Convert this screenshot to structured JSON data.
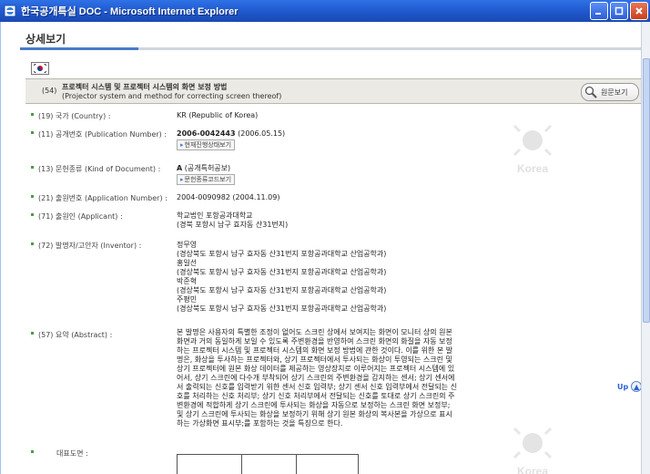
{
  "window": {
    "title": "한국공개특실 DOC - Microsoft Internet Explorer"
  },
  "page": {
    "heading": "상세보기"
  },
  "patent": {
    "num_code": "(54)",
    "title_ko": "프로젝터 시스템 및 프로젝터 시스템의 화면 보정 방법",
    "title_en": "(Projector system and method for correcting screen thereof)",
    "original_button": "원문보기"
  },
  "fields": {
    "country": {
      "label": "(19) 국가 (Country) :",
      "value": "KR (Republic of Korea)"
    },
    "publication": {
      "label": "(11) 공개번호 (Publication Number) :",
      "number": "2006-0042443",
      "date": "(2006.05.15)",
      "button": "현재진행상태보기"
    },
    "kind": {
      "label": "(13) 문헌종류 (Kind of Document) :",
      "code": "A",
      "desc": "(공개특허공보)",
      "button": "문헌종류코드보기"
    },
    "application": {
      "label": "(21) 출원번호 (Application Number) :",
      "value": "2004-0090982 (2004.11.09)"
    },
    "applicant": {
      "label": "(71) 출원인 (Applicant) :",
      "name": "학교법인 포항공과대학교",
      "address": "(경북 포항시 남구 효자동 산31번지)"
    },
    "inventor": {
      "label": "(72) 발명자/고안자 (Inventor) :",
      "entries": [
        {
          "name": "정무영",
          "address": "(경상북도 포항시 남구 효자동 산31번지 포항공과대학교 산업공학과)"
        },
        {
          "name": "홍일선",
          "address": "(경상북도 포항시 남구 효자동 산31번지 포항공과대학교 산업공학과)"
        },
        {
          "name": "박준혁",
          "address": "(경상북도 포항시 남구 효자동 산31번지 포항공과대학교 산업공학과)"
        },
        {
          "name": "주평민",
          "address": "(경상북도 포항시 남구 효자동 산31번지 포항공과대학교 산업공학과)"
        }
      ]
    },
    "abstract": {
      "label": "(57) 요약 (Abstract) :",
      "lines": [
        "본 발명은 사용자의 특별한 조정이 없어도 스크린 상에서 보여지는 화면이 모니터 상의 원본",
        "화면과 거의 동일하게 보일 수 있도록 주변환경을 반영하여 스크린 화면의 화질을 자동 보정",
        "하는 프로젝터 시스템 및 프로젝터 시스템의 화면 보정 방법에 관한 것이다. 이를 위한 본 발",
        "명은, 화상을 투사하는 프로젝터와, 상기 프로젝터에서 투사되는 화상이 투영되는 스크린 및",
        "상기 프로젝터에 원본 화상 데이터를 제공하는 영상장치로 이루어지는 프로젝터 시스템에 있",
        "어서, 상기 스크린에 다수개 부착되어 상기 스크린의 주변환경을 감지하는 센서; 상기 센서에",
        "서 출력되는 신호를 입력받기 위한 센서 신호 입력부; 상기 센서 신호 입력부에서 전달되는 신",
        "호를 처리하는 신호 처리부; 상기 신호 처리부에서 전달되는 신호를 토대로 상기 스크린의 주",
        "변환경에 적합하게 상기 스크린에 투사되는 화상을 자동으로 보정하는 스크린 화면 보정부;",
        "및 상기 스크린에 투사되는 화상을 보정하기 위해 상기 원본 화상의 복사본을 가상으로 표시",
        "하는 가상화면 표시부;를 포함하는 것을 특징으로 한다."
      ]
    },
    "representative": {
      "label": "대표도면 :"
    }
  },
  "watermark": {
    "text": "Korea"
  },
  "up_link": {
    "label": "Up"
  },
  "colors": {
    "titlebar": "#2f71e6",
    "accent_rule": "#4a7bc8",
    "header_bg": "#eceae4",
    "bullet": "#4a9a4a"
  }
}
